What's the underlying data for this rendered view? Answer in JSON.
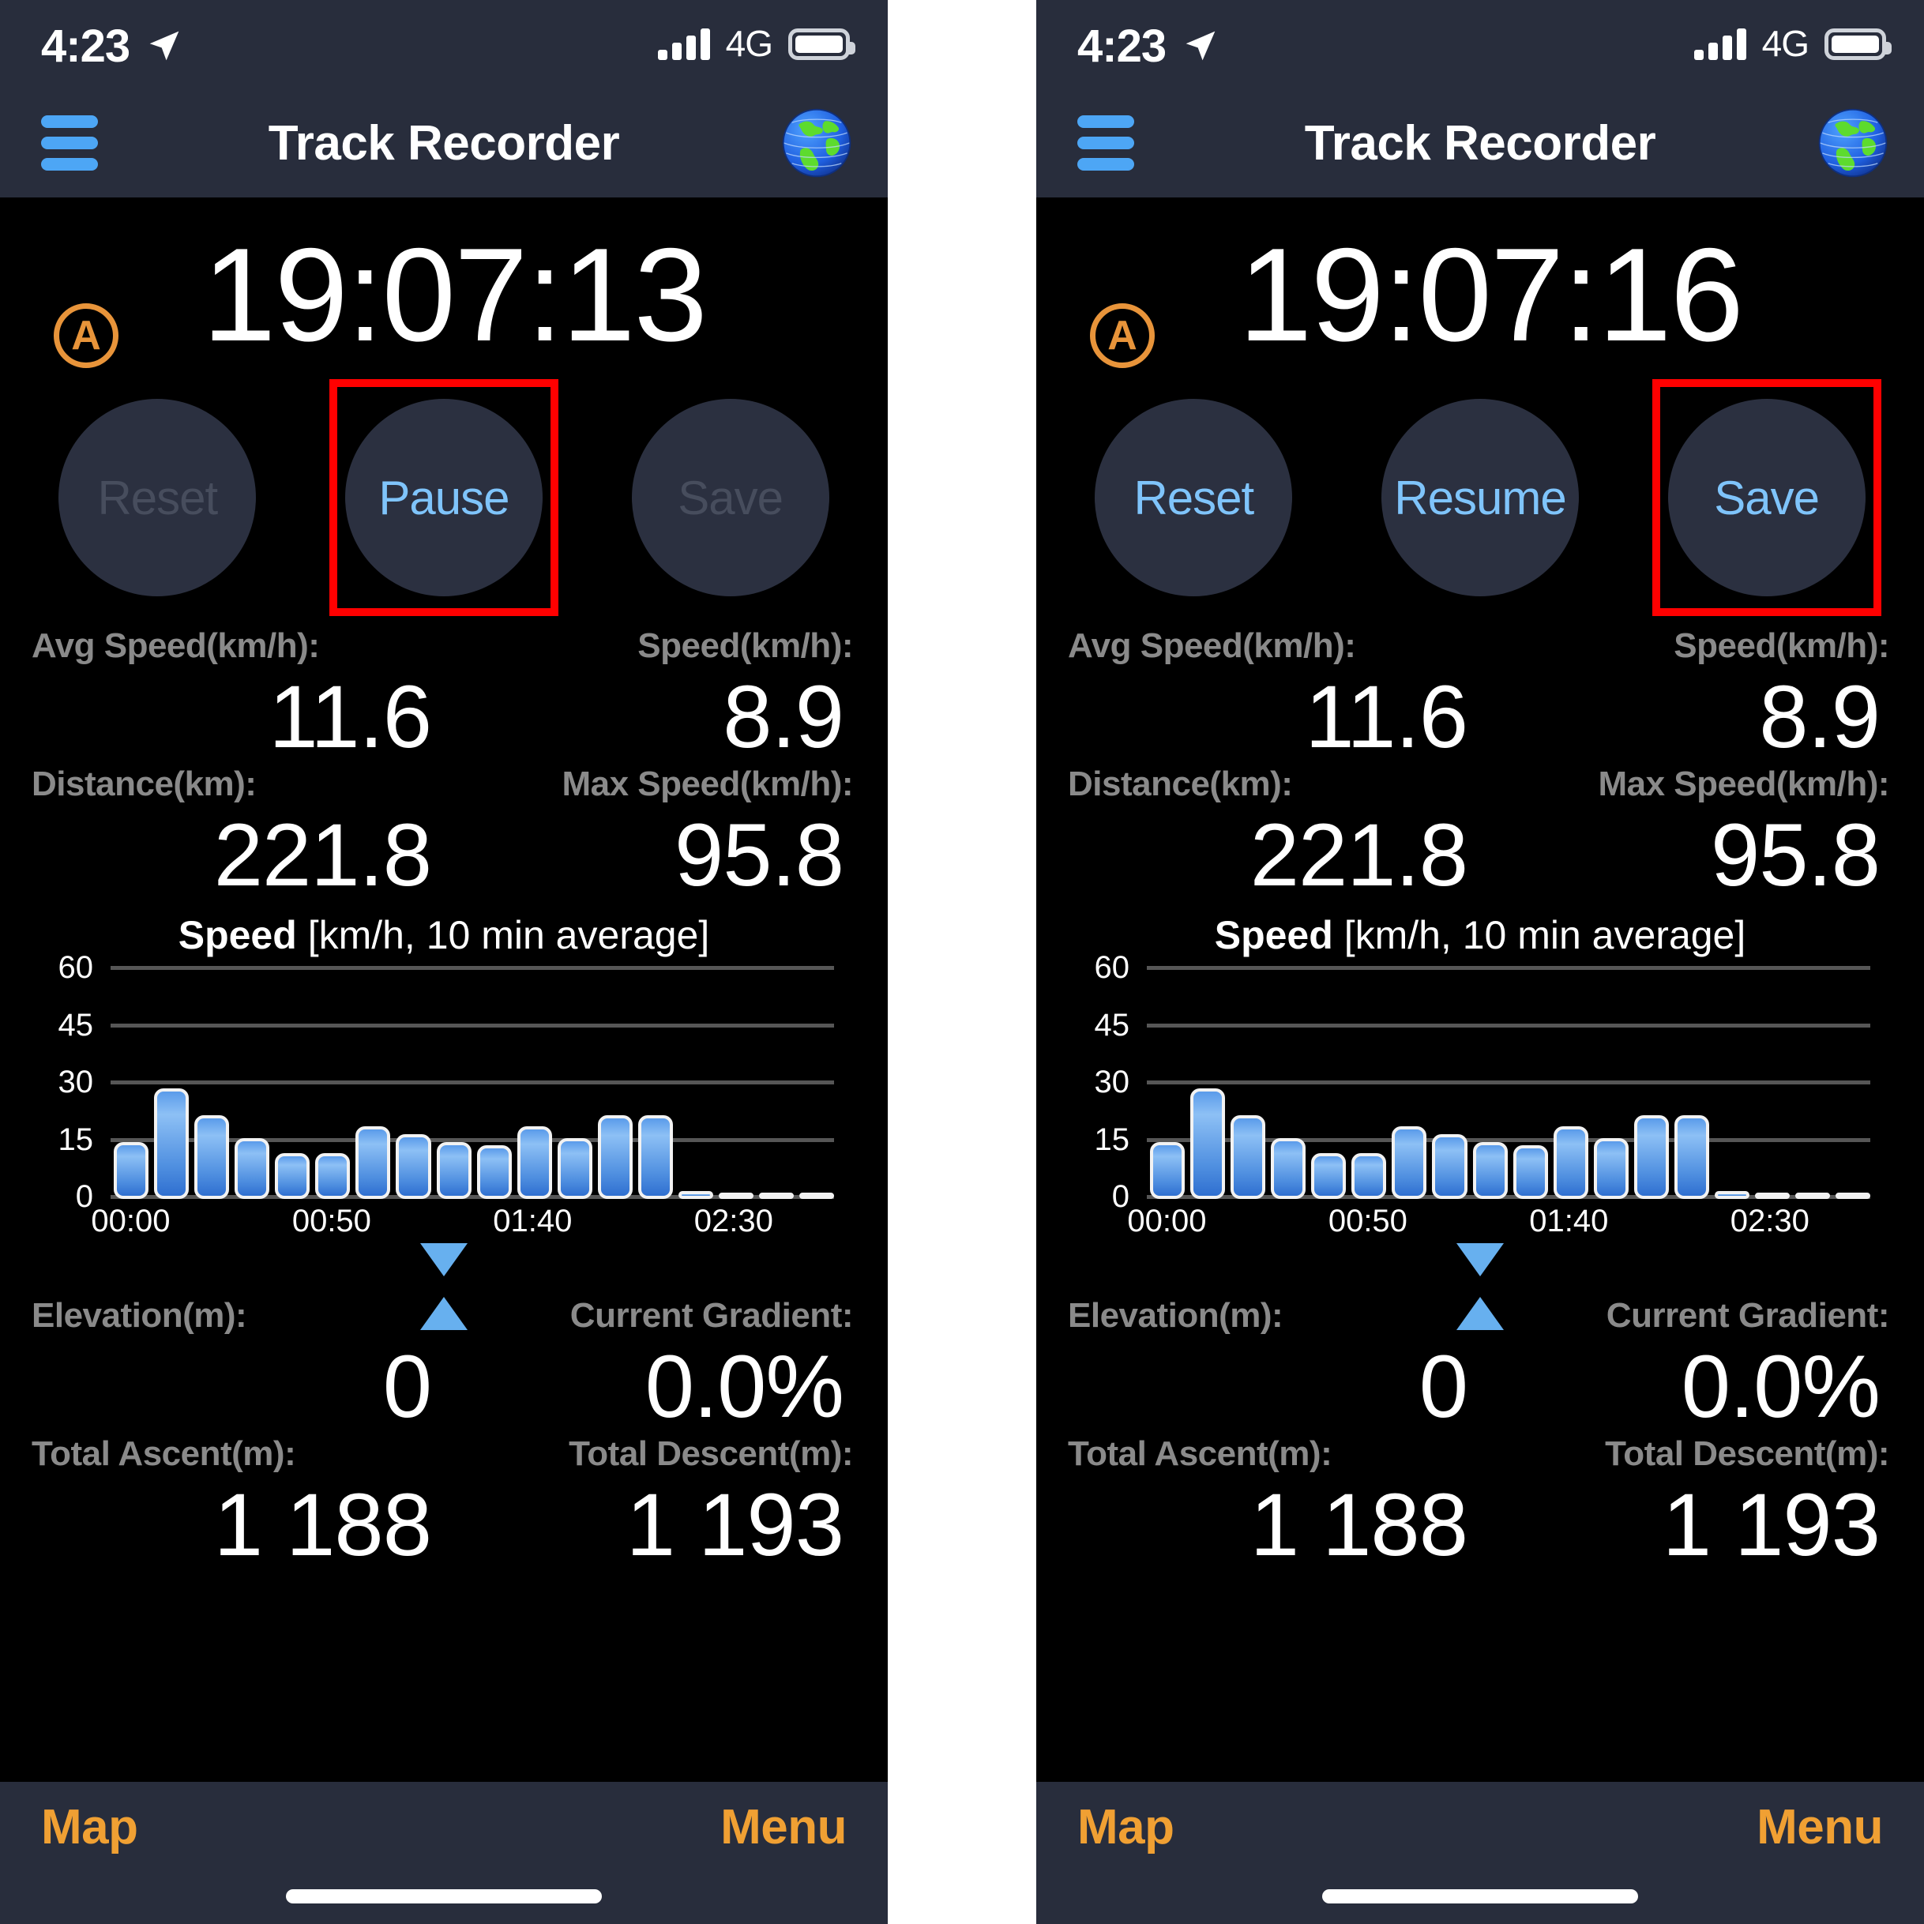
{
  "panels": [
    {
      "status_bar": {
        "time": "4:23",
        "location_icon": "location-arrow-icon",
        "signal_icon": "cellular-signal-icon",
        "network": "4G",
        "battery_icon": "battery-full-icon"
      },
      "nav": {
        "menu_icon": "hamburger-menu-icon",
        "title": "Track Recorder",
        "globe_icon": "globe-icon"
      },
      "timer": {
        "auto_badge": "A",
        "value": "19:07:13"
      },
      "buttons": [
        {
          "label": "Reset",
          "state": "disabled",
          "highlighted": false
        },
        {
          "label": "Pause",
          "state": "enabled",
          "highlighted": true
        },
        {
          "label": "Save",
          "state": "disabled",
          "highlighted": false
        }
      ],
      "stats": [
        [
          {
            "label": "Avg Speed(km/h):",
            "value": "11.6"
          },
          {
            "label": "Speed(km/h):",
            "value": "8.9"
          }
        ],
        [
          {
            "label": "Distance(km):",
            "value": "221.8"
          },
          {
            "label": "Max Speed(km/h):",
            "value": "95.8"
          }
        ]
      ],
      "chart_title_bold": "Speed",
      "chart_title_rest": " [km/h, 10 min average]",
      "elevation": [
        [
          {
            "label": "Elevation(m):",
            "value": "0"
          },
          {
            "label": "Current Gradient:",
            "value": "0.0%"
          }
        ],
        [
          {
            "label": "Total Ascent(m):",
            "value": "1 188"
          },
          {
            "label": "Total Descent(m):",
            "value": "1 193"
          }
        ]
      ],
      "tabs": {
        "left": "Map",
        "right": "Menu"
      }
    },
    {
      "status_bar": {
        "time": "4:23",
        "location_icon": "location-arrow-icon",
        "signal_icon": "cellular-signal-icon",
        "network": "4G",
        "battery_icon": "battery-full-icon"
      },
      "nav": {
        "menu_icon": "hamburger-menu-icon",
        "title": "Track Recorder",
        "globe_icon": "globe-icon"
      },
      "timer": {
        "auto_badge": "A",
        "value": "19:07:16"
      },
      "buttons": [
        {
          "label": "Reset",
          "state": "enabled",
          "highlighted": false
        },
        {
          "label": "Resume",
          "state": "enabled",
          "highlighted": false
        },
        {
          "label": "Save",
          "state": "enabled",
          "highlighted": true
        }
      ],
      "stats": [
        [
          {
            "label": "Avg Speed(km/h):",
            "value": "11.6"
          },
          {
            "label": "Speed(km/h):",
            "value": "8.9"
          }
        ],
        [
          {
            "label": "Distance(km):",
            "value": "221.8"
          },
          {
            "label": "Max Speed(km/h):",
            "value": "95.8"
          }
        ]
      ],
      "chart_title_bold": "Speed",
      "chart_title_rest": " [km/h, 10 min average]",
      "elevation": [
        [
          {
            "label": "Elevation(m):",
            "value": "0"
          },
          {
            "label": "Current Gradient:",
            "value": "0.0%"
          }
        ],
        [
          {
            "label": "Total Ascent(m):",
            "value": "1 188"
          },
          {
            "label": "Total Descent(m):",
            "value": "1 193"
          }
        ]
      ],
      "tabs": {
        "left": "Map",
        "right": "Menu"
      }
    }
  ],
  "colors": {
    "chrome": "#282d3c",
    "accent_blue": "#4da6f5",
    "button_blue": "#7fc4fb",
    "button_disabled": "#474d5d",
    "tab_orange": "#f0a033",
    "badge_orange": "#e8943a",
    "highlight_red": "#ff0000",
    "bar_blue": "#5a9bea",
    "label_gray": "#8a8a8a",
    "screen_black": "#000000"
  },
  "chart_data": {
    "type": "bar",
    "title": "Speed [km/h, 10 min average]",
    "xlabel": "",
    "ylabel": "km/h",
    "ylim": [
      0,
      60
    ],
    "yticks": [
      0,
      15,
      30,
      45,
      60
    ],
    "grid": true,
    "legend": "none",
    "xtick_labels": [
      "00:00",
      "00:50",
      "01:40",
      "02:30"
    ],
    "xtick_positions": [
      0,
      5,
      10,
      15
    ],
    "categories": [
      "00:00",
      "00:10",
      "00:20",
      "00:30",
      "00:40",
      "00:50",
      "01:00",
      "01:10",
      "01:20",
      "01:30",
      "01:40",
      "01:50",
      "02:00",
      "02:10",
      "02:20",
      "02:30",
      "02:40",
      "02:50"
    ],
    "values": [
      15,
      29,
      22,
      16,
      12,
      12,
      19,
      17,
      15,
      14,
      19,
      16,
      22,
      22,
      2,
      0.5,
      0.5,
      0
    ]
  }
}
